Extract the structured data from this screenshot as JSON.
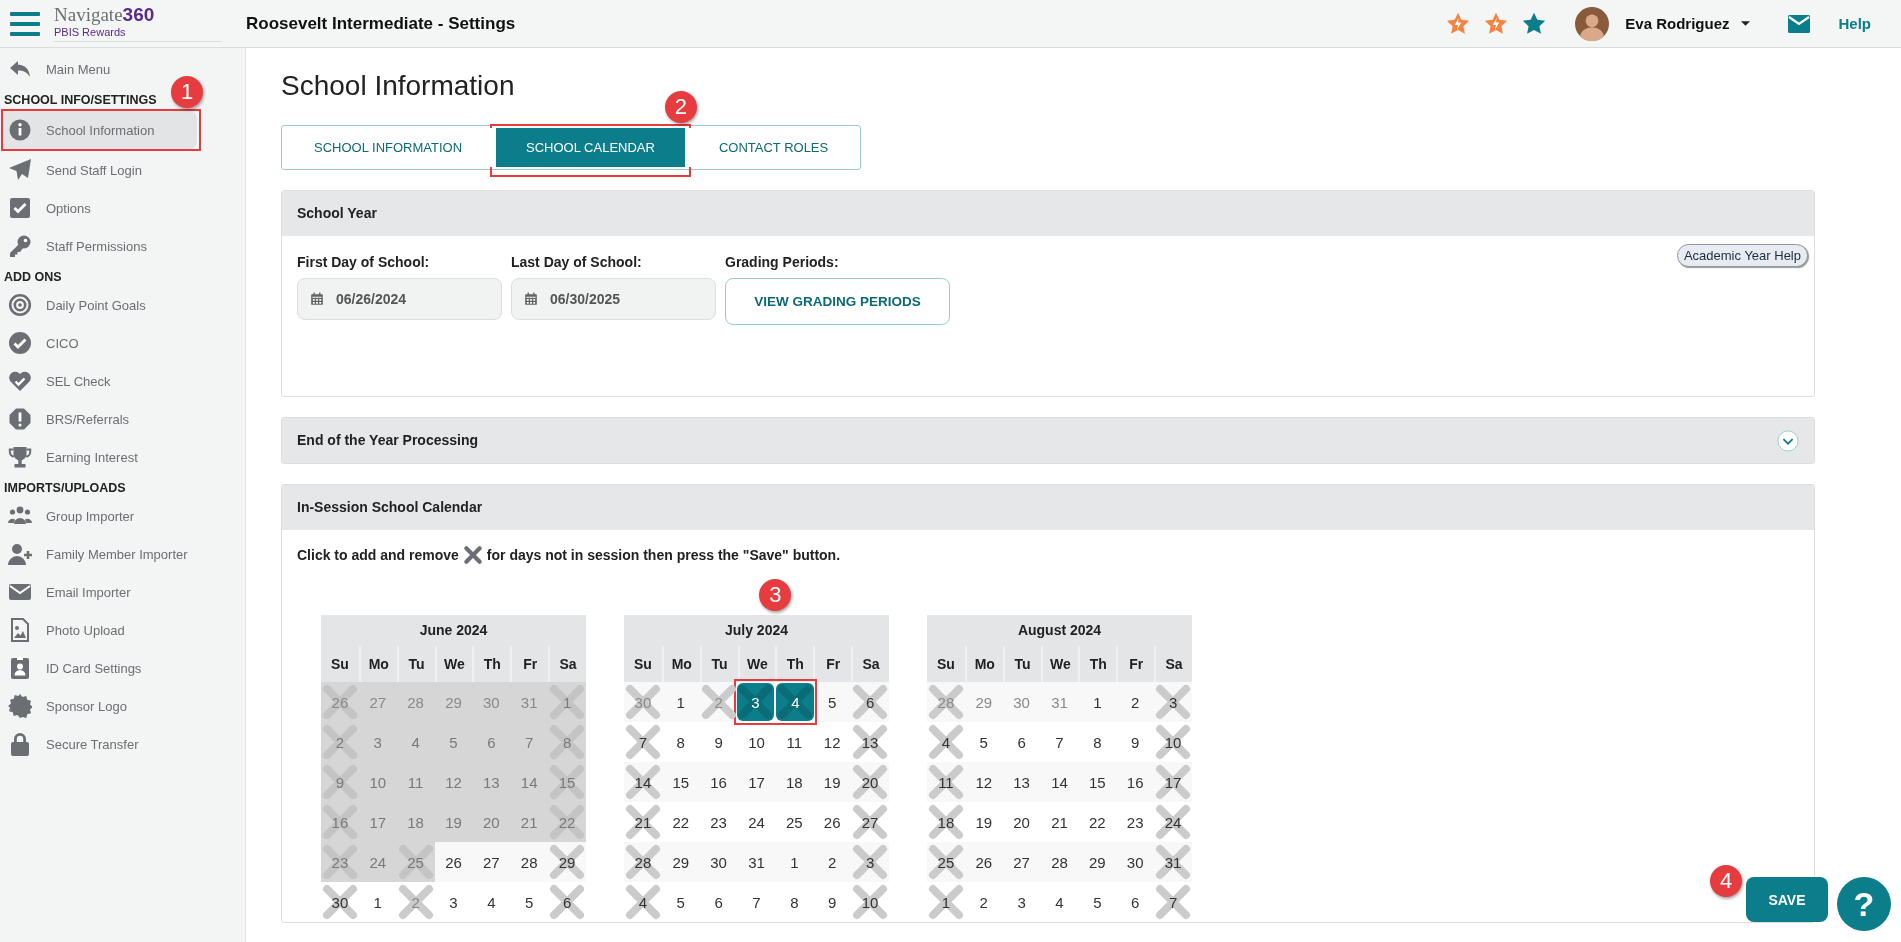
{
  "header": {
    "logo": "Navigate**360**",
    "logo_sub": "PBIS Rewards",
    "title": "Roosevelt Intermediate - Settings",
    "stars": [
      {
        "kind": "bolt",
        "color": "#f4843f"
      },
      {
        "kind": "bolt",
        "color": "#f4843f"
      },
      {
        "kind": "plain",
        "color": "#0c7d8a"
      }
    ],
    "user": "Eva Rodriguez",
    "help": "Help"
  },
  "sidebar": {
    "main_menu": "Main Menu",
    "sections": [
      {
        "title": "SCHOOL INFO/SETTINGS",
        "items": [
          {
            "label": "School Information",
            "selected": true,
            "callout": "1"
          },
          {
            "label": "Send Staff Login",
            "selected": false
          },
          {
            "label": "Options",
            "selected": false
          },
          {
            "label": "Staff Permissions",
            "selected": false
          }
        ]
      },
      {
        "title": "ADD ONS",
        "items": [
          {
            "label": "Daily Point Goals",
            "selected": false
          },
          {
            "label": "CICO",
            "selected": false
          },
          {
            "label": "SEL Check",
            "selected": false
          },
          {
            "label": "BRS/Referrals",
            "selected": false
          },
          {
            "label": "Earning Interest",
            "selected": false
          }
        ]
      },
      {
        "title": "IMPORTS/UPLOADS",
        "items": [
          {
            "label": "Group Importer",
            "selected": false
          },
          {
            "label": "Family Member Importer",
            "selected": false
          },
          {
            "label": "Email Importer",
            "selected": false
          },
          {
            "label": "Photo Upload",
            "selected": false
          },
          {
            "label": "ID Card Settings",
            "selected": false
          },
          {
            "label": "Sponsor Logo",
            "selected": false
          },
          {
            "label": "Secure Transfer",
            "selected": false
          }
        ]
      }
    ]
  },
  "page_title": "School Information",
  "tabs": [
    {
      "label": "SCHOOL INFORMATION",
      "selected": false
    },
    {
      "label": "SCHOOL CALENDAR",
      "selected": true,
      "callout": "2"
    },
    {
      "label": "CONTACT ROLES",
      "selected": false
    }
  ],
  "school_year": {
    "title": "School Year",
    "first_day": {
      "label": "First Day of School:",
      "value": "06/26/2024"
    },
    "last_day": {
      "label": "Last Day of School:",
      "value": "06/30/2025"
    },
    "grading_label": "Grading Periods:",
    "grading_button": "VIEW GRADING PERIODS",
    "help_button": "Academic Year Help"
  },
  "end_of_year": {
    "title": "End of the Year Processing",
    "expanded": false
  },
  "calendar_panel": {
    "title": "In-Session School Calendar",
    "instruction": [
      "Click to add and remove",
      "for days not in session then press the \"Save\" button."
    ]
  },
  "calendars": [
    {
      "title": "June 2024",
      "weekdays": [
        "Su",
        "Mo",
        "Tu",
        "We",
        "Th",
        "Fr",
        "Sa"
      ],
      "weeks": [
        [
          {
            "text": "26",
            "muted": true,
            "off": true,
            "before_start": true,
            "selected": false
          },
          {
            "text": "27",
            "muted": true,
            "off": false,
            "before_start": true,
            "selected": false
          },
          {
            "text": "28",
            "muted": true,
            "off": false,
            "before_start": true,
            "selected": false
          },
          {
            "text": "29",
            "muted": true,
            "off": false,
            "before_start": true,
            "selected": false
          },
          {
            "text": "30",
            "muted": true,
            "off": false,
            "before_start": true,
            "selected": false
          },
          {
            "text": "31",
            "muted": true,
            "off": false,
            "before_start": true,
            "selected": false
          },
          {
            "text": "1",
            "muted": false,
            "off": true,
            "before_start": true,
            "selected": false
          }
        ],
        [
          {
            "text": "2",
            "muted": false,
            "off": true,
            "before_start": true,
            "selected": false
          },
          {
            "text": "3",
            "muted": false,
            "off": false,
            "before_start": true,
            "selected": false
          },
          {
            "text": "4",
            "muted": false,
            "off": false,
            "before_start": true,
            "selected": false
          },
          {
            "text": "5",
            "muted": false,
            "off": false,
            "before_start": true,
            "selected": false
          },
          {
            "text": "6",
            "muted": false,
            "off": false,
            "before_start": true,
            "selected": false
          },
          {
            "text": "7",
            "muted": false,
            "off": false,
            "before_start": true,
            "selected": false
          },
          {
            "text": "8",
            "muted": false,
            "off": true,
            "before_start": true,
            "selected": false
          }
        ],
        [
          {
            "text": "9",
            "muted": false,
            "off": true,
            "before_start": true,
            "selected": false
          },
          {
            "text": "10",
            "muted": false,
            "off": false,
            "before_start": true,
            "selected": false
          },
          {
            "text": "11",
            "muted": false,
            "off": false,
            "before_start": true,
            "selected": false
          },
          {
            "text": "12",
            "muted": false,
            "off": false,
            "before_start": true,
            "selected": false
          },
          {
            "text": "13",
            "muted": false,
            "off": false,
            "before_start": true,
            "selected": false
          },
          {
            "text": "14",
            "muted": false,
            "off": false,
            "before_start": true,
            "selected": false
          },
          {
            "text": "15",
            "muted": false,
            "off": true,
            "before_start": true,
            "selected": false
          }
        ],
        [
          {
            "text": "16",
            "muted": false,
            "off": true,
            "before_start": true,
            "selected": false
          },
          {
            "text": "17",
            "muted": false,
            "off": false,
            "before_start": true,
            "selected": false
          },
          {
            "text": "18",
            "muted": false,
            "off": false,
            "before_start": true,
            "selected": false
          },
          {
            "text": "19",
            "muted": false,
            "off": false,
            "before_start": true,
            "selected": false
          },
          {
            "text": "20",
            "muted": false,
            "off": false,
            "before_start": true,
            "selected": false
          },
          {
            "text": "21",
            "muted": false,
            "off": false,
            "before_start": true,
            "selected": false
          },
          {
            "text": "22",
            "muted": false,
            "off": true,
            "before_start": true,
            "selected": false
          }
        ],
        [
          {
            "text": "23",
            "muted": false,
            "off": true,
            "before_start": true,
            "selected": false
          },
          {
            "text": "24",
            "muted": false,
            "off": false,
            "before_start": true,
            "selected": false
          },
          {
            "text": "25",
            "muted": false,
            "off": true,
            "before_start": true,
            "selected": false
          },
          {
            "text": "26",
            "muted": false,
            "off": false,
            "before_start": false,
            "selected": false
          },
          {
            "text": "27",
            "muted": false,
            "off": false,
            "before_start": false,
            "selected": false
          },
          {
            "text": "28",
            "muted": false,
            "off": false,
            "before_start": false,
            "selected": false
          },
          {
            "text": "29",
            "muted": false,
            "off": true,
            "before_start": false,
            "selected": false
          }
        ],
        [
          {
            "text": "30",
            "muted": false,
            "off": true,
            "before_start": false,
            "selected": false
          },
          {
            "text": "1",
            "muted": false,
            "off": false,
            "before_start": false,
            "selected": false
          },
          {
            "text": "2",
            "muted": true,
            "off": true,
            "before_start": false,
            "selected": false
          },
          {
            "text": "3",
            "muted": false,
            "off": false,
            "before_start": false,
            "selected": false
          },
          {
            "text": "4",
            "muted": false,
            "off": false,
            "before_start": false,
            "selected": false
          },
          {
            "text": "5",
            "muted": false,
            "off": false,
            "before_start": false,
            "selected": false
          },
          {
            "text": "6",
            "muted": false,
            "off": true,
            "before_start": false,
            "selected": false
          }
        ]
      ]
    },
    {
      "title": "July 2024",
      "weekdays": [
        "Su",
        "Mo",
        "Tu",
        "We",
        "Th",
        "Fr",
        "Sa"
      ],
      "weeks": [
        [
          {
            "text": "30",
            "muted": true,
            "off": true,
            "before_start": false,
            "selected": false
          },
          {
            "text": "1",
            "muted": false,
            "off": false,
            "before_start": false,
            "selected": false
          },
          {
            "text": "2",
            "muted": true,
            "off": true,
            "before_start": false,
            "selected": false
          },
          {
            "text": "3",
            "muted": false,
            "off": true,
            "before_start": false,
            "selected": true,
            "callout": "3"
          },
          {
            "text": "4",
            "muted": false,
            "off": true,
            "before_start": false,
            "selected": true
          },
          {
            "text": "5",
            "muted": false,
            "off": false,
            "before_start": false,
            "selected": false
          },
          {
            "text": "6",
            "muted": false,
            "off": true,
            "before_start": false,
            "selected": false
          }
        ],
        [
          {
            "text": "7",
            "muted": false,
            "off": true,
            "before_start": false,
            "selected": false
          },
          {
            "text": "8",
            "muted": false,
            "off": false,
            "before_start": false,
            "selected": false
          },
          {
            "text": "9",
            "muted": false,
            "off": false,
            "before_start": false,
            "selected": false
          },
          {
            "text": "10",
            "muted": false,
            "off": false,
            "before_start": false,
            "selected": false
          },
          {
            "text": "11",
            "muted": false,
            "off": false,
            "before_start": false,
            "selected": false
          },
          {
            "text": "12",
            "muted": false,
            "off": false,
            "before_start": false,
            "selected": false
          },
          {
            "text": "13",
            "muted": false,
            "off": true,
            "before_start": false,
            "selected": false
          }
        ],
        [
          {
            "text": "14",
            "muted": false,
            "off": true,
            "before_start": false,
            "selected": false
          },
          {
            "text": "15",
            "muted": false,
            "off": false,
            "before_start": false,
            "selected": false
          },
          {
            "text": "16",
            "muted": false,
            "off": false,
            "before_start": false,
            "selected": false
          },
          {
            "text": "17",
            "muted": false,
            "off": false,
            "before_start": false,
            "selected": false
          },
          {
            "text": "18",
            "muted": false,
            "off": false,
            "before_start": false,
            "selected": false
          },
          {
            "text": "19",
            "muted": false,
            "off": false,
            "before_start": false,
            "selected": false
          },
          {
            "text": "20",
            "muted": false,
            "off": true,
            "before_start": false,
            "selected": false
          }
        ],
        [
          {
            "text": "21",
            "muted": false,
            "off": true,
            "before_start": false,
            "selected": false
          },
          {
            "text": "22",
            "muted": false,
            "off": false,
            "before_start": false,
            "selected": false
          },
          {
            "text": "23",
            "muted": false,
            "off": false,
            "before_start": false,
            "selected": false
          },
          {
            "text": "24",
            "muted": false,
            "off": false,
            "before_start": false,
            "selected": false
          },
          {
            "text": "25",
            "muted": false,
            "off": false,
            "before_start": false,
            "selected": false
          },
          {
            "text": "26",
            "muted": false,
            "off": false,
            "before_start": false,
            "selected": false
          },
          {
            "text": "27",
            "muted": false,
            "off": true,
            "before_start": false,
            "selected": false
          }
        ],
        [
          {
            "text": "28",
            "muted": false,
            "off": true,
            "before_start": false,
            "selected": false
          },
          {
            "text": "29",
            "muted": false,
            "off": false,
            "before_start": false,
            "selected": false
          },
          {
            "text": "30",
            "muted": false,
            "off": false,
            "before_start": false,
            "selected": false
          },
          {
            "text": "31",
            "muted": false,
            "off": false,
            "before_start": false,
            "selected": false
          },
          {
            "text": "1",
            "muted": false,
            "off": false,
            "before_start": false,
            "selected": false
          },
          {
            "text": "2",
            "muted": false,
            "off": false,
            "before_start": false,
            "selected": false
          },
          {
            "text": "3",
            "muted": false,
            "off": true,
            "before_start": false,
            "selected": false
          }
        ],
        [
          {
            "text": "4",
            "muted": false,
            "off": true,
            "before_start": false,
            "selected": false
          },
          {
            "text": "5",
            "muted": false,
            "off": false,
            "before_start": false,
            "selected": false
          },
          {
            "text": "6",
            "muted": false,
            "off": false,
            "before_start": false,
            "selected": false
          },
          {
            "text": "7",
            "muted": false,
            "off": false,
            "before_start": false,
            "selected": false
          },
          {
            "text": "8",
            "muted": false,
            "off": false,
            "before_start": false,
            "selected": false
          },
          {
            "text": "9",
            "muted": false,
            "off": false,
            "before_start": false,
            "selected": false
          },
          {
            "text": "10",
            "muted": false,
            "off": true,
            "before_start": false,
            "selected": false
          }
        ]
      ]
    },
    {
      "title": "August 2024",
      "weekdays": [
        "Su",
        "Mo",
        "Tu",
        "We",
        "Th",
        "Fr",
        "Sa"
      ],
      "weeks": [
        [
          {
            "text": "28",
            "muted": true,
            "off": true,
            "before_start": false,
            "selected": false
          },
          {
            "text": "29",
            "muted": true,
            "off": false,
            "before_start": false,
            "selected": false
          },
          {
            "text": "30",
            "muted": true,
            "off": false,
            "before_start": false,
            "selected": false
          },
          {
            "text": "31",
            "muted": true,
            "off": false,
            "before_start": false,
            "selected": false
          },
          {
            "text": "1",
            "muted": false,
            "off": false,
            "before_start": false,
            "selected": false
          },
          {
            "text": "2",
            "muted": false,
            "off": false,
            "before_start": false,
            "selected": false
          },
          {
            "text": "3",
            "muted": false,
            "off": true,
            "before_start": false,
            "selected": false
          }
        ],
        [
          {
            "text": "4",
            "muted": false,
            "off": true,
            "before_start": false,
            "selected": false
          },
          {
            "text": "5",
            "muted": false,
            "off": false,
            "before_start": false,
            "selected": false
          },
          {
            "text": "6",
            "muted": false,
            "off": false,
            "before_start": false,
            "selected": false
          },
          {
            "text": "7",
            "muted": false,
            "off": false,
            "before_start": false,
            "selected": false
          },
          {
            "text": "8",
            "muted": false,
            "off": false,
            "before_start": false,
            "selected": false
          },
          {
            "text": "9",
            "muted": false,
            "off": false,
            "before_start": false,
            "selected": false
          },
          {
            "text": "10",
            "muted": false,
            "off": true,
            "before_start": false,
            "selected": false
          }
        ],
        [
          {
            "text": "11",
            "muted": false,
            "off": true,
            "before_start": false,
            "selected": false
          },
          {
            "text": "12",
            "muted": false,
            "off": false,
            "before_start": false,
            "selected": false
          },
          {
            "text": "13",
            "muted": false,
            "off": false,
            "before_start": false,
            "selected": false
          },
          {
            "text": "14",
            "muted": false,
            "off": false,
            "before_start": false,
            "selected": false
          },
          {
            "text": "15",
            "muted": false,
            "off": false,
            "before_start": false,
            "selected": false
          },
          {
            "text": "16",
            "muted": false,
            "off": false,
            "before_start": false,
            "selected": false
          },
          {
            "text": "17",
            "muted": false,
            "off": true,
            "before_start": false,
            "selected": false
          }
        ],
        [
          {
            "text": "18",
            "muted": false,
            "off": true,
            "before_start": false,
            "selected": false
          },
          {
            "text": "19",
            "muted": false,
            "off": false,
            "before_start": false,
            "selected": false
          },
          {
            "text": "20",
            "muted": false,
            "off": false,
            "before_start": false,
            "selected": false
          },
          {
            "text": "21",
            "muted": false,
            "off": false,
            "before_start": false,
            "selected": false
          },
          {
            "text": "22",
            "muted": false,
            "off": false,
            "before_start": false,
            "selected": false
          },
          {
            "text": "23",
            "muted": false,
            "off": false,
            "before_start": false,
            "selected": false
          },
          {
            "text": "24",
            "muted": false,
            "off": true,
            "before_start": false,
            "selected": false
          }
        ],
        [
          {
            "text": "25",
            "muted": false,
            "off": true,
            "before_start": false,
            "selected": false
          },
          {
            "text": "26",
            "muted": false,
            "off": false,
            "before_start": false,
            "selected": false
          },
          {
            "text": "27",
            "muted": false,
            "off": false,
            "before_start": false,
            "selected": false
          },
          {
            "text": "28",
            "muted": false,
            "off": false,
            "before_start": false,
            "selected": false
          },
          {
            "text": "29",
            "muted": false,
            "off": false,
            "before_start": false,
            "selected": false
          },
          {
            "text": "30",
            "muted": false,
            "off": false,
            "before_start": false,
            "selected": false
          },
          {
            "text": "31",
            "muted": false,
            "off": true,
            "before_start": false,
            "selected": false
          }
        ],
        [
          {
            "text": "1",
            "muted": false,
            "off": true,
            "before_start": false,
            "selected": false
          },
          {
            "text": "2",
            "muted": false,
            "off": false,
            "before_start": false,
            "selected": false
          },
          {
            "text": "3",
            "muted": false,
            "off": false,
            "before_start": false,
            "selected": false
          },
          {
            "text": "4",
            "muted": false,
            "off": false,
            "before_start": false,
            "selected": false
          },
          {
            "text": "5",
            "muted": false,
            "off": false,
            "before_start": false,
            "selected": false
          },
          {
            "text": "6",
            "muted": false,
            "off": false,
            "before_start": false,
            "selected": false
          },
          {
            "text": "7",
            "muted": false,
            "off": true,
            "before_start": false,
            "selected": false
          }
        ]
      ]
    }
  ],
  "save_button": {
    "label": "SAVE",
    "callout": "4"
  },
  "help_fab": "?"
}
